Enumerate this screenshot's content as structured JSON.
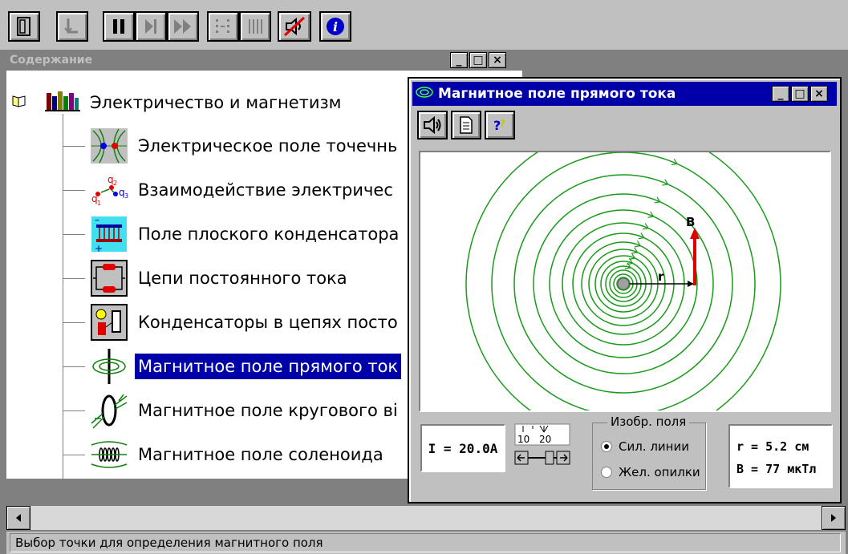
{
  "toolbar": {
    "buttons": [
      "exit-icon",
      "pointer-icon",
      "pause-icon",
      "step-icon",
      "fast-forward-icon",
      "grid-icon",
      "bars-icon",
      "sound-off-icon",
      "info-icon"
    ]
  },
  "contents": {
    "title": "Содержание",
    "root_label": "Электричество и магнетизм",
    "items": [
      {
        "label": "Электрическое поле точечнь",
        "icon": "point-charge-field-icon"
      },
      {
        "label": "Взаимодействие электричес",
        "icon": "charges-interaction-icon"
      },
      {
        "label": "Поле плоского конденсатора",
        "icon": "capacitor-field-icon"
      },
      {
        "label": "Цепи постоянного тока",
        "icon": "dc-circuit-icon"
      },
      {
        "label": "Конденсаторы в цепях посто",
        "icon": "capacitor-circuit-icon"
      },
      {
        "label": "Магнитное поле прямого ток",
        "icon": "straight-current-field-icon",
        "selected": true
      },
      {
        "label": "Магнитное поле кругового ві",
        "icon": "loop-current-field-icon"
      },
      {
        "label": "Магнитное поле соленоида",
        "icon": "solenoid-field-icon"
      }
    ]
  },
  "window_buttons": {
    "minimize": "_",
    "maximize": "□",
    "close": "×"
  },
  "mag_window": {
    "title": "Магнитное поле прямого тока",
    "toolbar": [
      "sound-icon",
      "document-icon",
      "help-icon"
    ],
    "field_labels": {
      "b": "B",
      "r": "r"
    },
    "current": "I = 20.0A",
    "scale": {
      "min": "10",
      "max": "20"
    },
    "display_group": {
      "legend": "Изобр. поля",
      "options": [
        {
          "label": "Сил. линии",
          "selected": true
        },
        {
          "label": "Жел. опилки",
          "selected": false
        }
      ]
    },
    "readout": {
      "r": "r  = 5.2 см",
      "b": "B  = 77 мкТл"
    }
  },
  "status_text": "Выбор точки для определения магнитного поля",
  "colors": {
    "selection": "#0000a8",
    "title_active": "#0000a8",
    "field_lines": "#1a9a1a",
    "vector": "#e00000"
  }
}
